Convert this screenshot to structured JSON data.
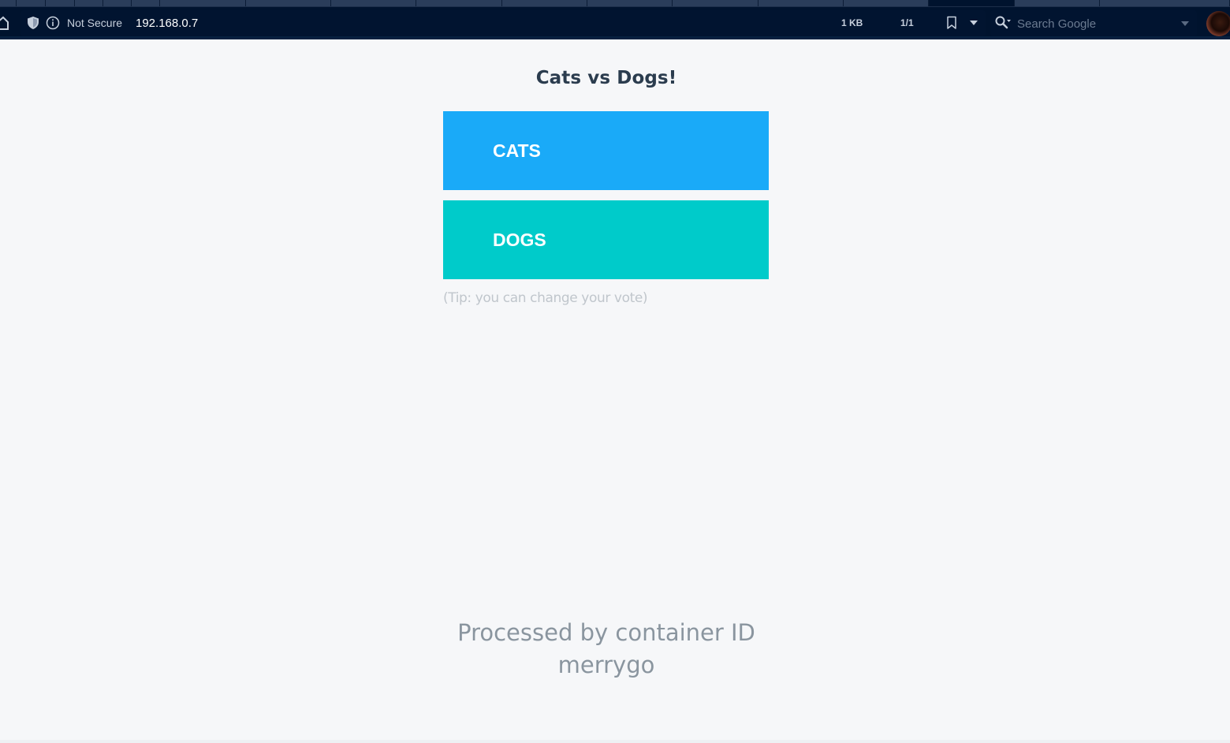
{
  "browser": {
    "security_label": "Not Secure",
    "url": "192.168.0.7",
    "page_size": "1 KB",
    "page_count": "1/1",
    "search_placeholder": "Search Google",
    "colors": {
      "chrome": "#00132e",
      "address_bar": "#011430"
    },
    "icons": [
      "home-icon",
      "shield-icon",
      "info-icon",
      "bookmark-icon",
      "chevron-down-icon",
      "search-icon",
      "avatar"
    ]
  },
  "page": {
    "title": "Cats vs Dogs!",
    "buttons": [
      {
        "label": "CATS",
        "color": "#1aaaf8"
      },
      {
        "label": "DOGS",
        "color": "#00cbca"
      }
    ],
    "tip": "(Tip: you can change your vote)",
    "footer_line1": "Processed by container ID",
    "footer_line2": "merrygo",
    "colors": {
      "background": "#f6f7f9",
      "title": "#2b3c4e",
      "tip": "#c0c6cc",
      "footer": "#8a959f"
    }
  }
}
